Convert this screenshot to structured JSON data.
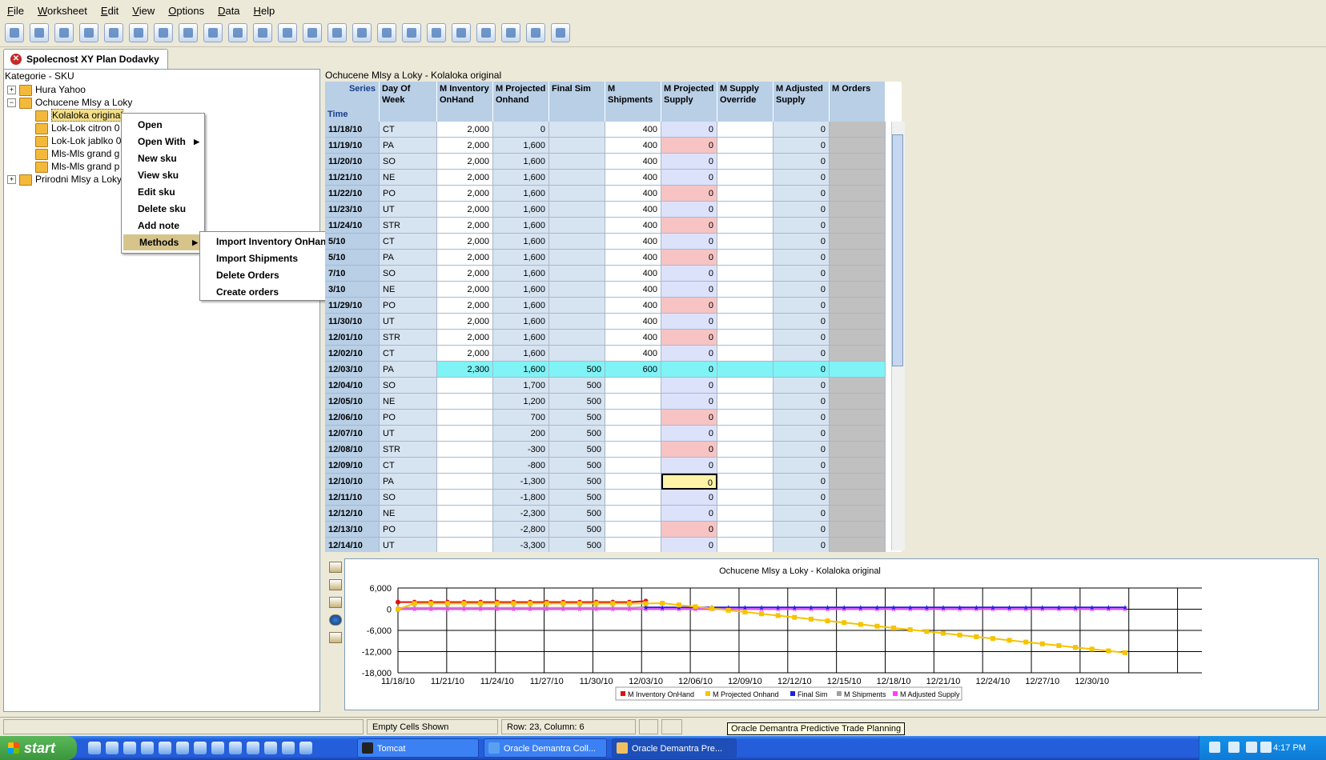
{
  "menubar": [
    "File",
    "Worksheet",
    "Edit",
    "View",
    "Options",
    "Data",
    "Help"
  ],
  "tab": {
    "title": "Spolecnost XY Plan Dodavky"
  },
  "left_panel": {
    "title": "Kategorie - SKU",
    "tree": [
      {
        "label": "Hura Yahoo",
        "level": 0,
        "toggle": "+"
      },
      {
        "label": "Ochucene Mlsy a Loky",
        "level": 0,
        "toggle": "-"
      },
      {
        "label": "Kolaloka original",
        "level": 1,
        "selected": true
      },
      {
        "label": "Lok-Lok citron 0",
        "level": 1
      },
      {
        "label": "Lok-Lok jablko 0",
        "level": 1
      },
      {
        "label": "Mls-Mls grand g",
        "level": 1
      },
      {
        "label": "Mls-Mls grand p",
        "level": 1
      },
      {
        "label": "Prirodni Mlsy a Loky",
        "level": 0,
        "toggle": "+"
      }
    ]
  },
  "context_menu": {
    "items": [
      "Open",
      "Open With",
      "New sku",
      "View sku",
      "Edit sku",
      "Delete sku",
      "Add note",
      "Methods"
    ],
    "submenu": [
      "Import Inventory OnHand",
      "Import Shipments",
      "Delete Orders",
      "Create orders"
    ]
  },
  "grid": {
    "title": "Ochucene Mlsy a Loky - Kolaloka original",
    "corner": {
      "series": "Series",
      "time": "Time"
    },
    "headers": [
      "Day Of Week",
      "M Inventory OnHand",
      "M Projected Onhand",
      "Final Sim",
      "M Shipments",
      "M Projected Supply",
      "M Supply Override",
      "M Adjusted Supply",
      "M Orders"
    ],
    "rows": [
      [
        "11/18/10",
        "CT",
        "2,000",
        "0",
        "",
        "400",
        "0",
        "",
        "0"
      ],
      [
        "11/19/10",
        "PA",
        "2,000",
        "1,600",
        "",
        "400",
        "0",
        "",
        "0"
      ],
      [
        "11/20/10",
        "SO",
        "2,000",
        "1,600",
        "",
        "400",
        "0",
        "",
        "0"
      ],
      [
        "11/21/10",
        "NE",
        "2,000",
        "1,600",
        "",
        "400",
        "0",
        "",
        "0"
      ],
      [
        "11/22/10",
        "PO",
        "2,000",
        "1,600",
        "",
        "400",
        "0",
        "",
        "0"
      ],
      [
        "11/23/10",
        "UT",
        "2,000",
        "1,600",
        "",
        "400",
        "0",
        "",
        "0"
      ],
      [
        "11/24/10",
        "STR",
        "2,000",
        "1,600",
        "",
        "400",
        "0",
        "",
        "0"
      ],
      [
        "5/10",
        "CT",
        "2,000",
        "1,600",
        "",
        "400",
        "0",
        "",
        "0"
      ],
      [
        "5/10",
        "PA",
        "2,000",
        "1,600",
        "",
        "400",
        "0",
        "",
        "0"
      ],
      [
        "7/10",
        "SO",
        "2,000",
        "1,600",
        "",
        "400",
        "0",
        "",
        "0"
      ],
      [
        "3/10",
        "NE",
        "2,000",
        "1,600",
        "",
        "400",
        "0",
        "",
        "0"
      ],
      [
        "11/29/10",
        "PO",
        "2,000",
        "1,600",
        "",
        "400",
        "0",
        "",
        "0"
      ],
      [
        "11/30/10",
        "UT",
        "2,000",
        "1,600",
        "",
        "400",
        "0",
        "",
        "0"
      ],
      [
        "12/01/10",
        "STR",
        "2,000",
        "1,600",
        "",
        "400",
        "0",
        "",
        "0"
      ],
      [
        "12/02/10",
        "CT",
        "2,000",
        "1,600",
        "",
        "400",
        "0",
        "",
        "0"
      ],
      [
        "12/03/10",
        "PA",
        "2,300",
        "1,600",
        "500",
        "600",
        "0",
        "",
        "0"
      ],
      [
        "12/04/10",
        "SO",
        "",
        "1,700",
        "500",
        "",
        "0",
        "",
        "0"
      ],
      [
        "12/05/10",
        "NE",
        "",
        "1,200",
        "500",
        "",
        "0",
        "",
        "0"
      ],
      [
        "12/06/10",
        "PO",
        "",
        "700",
        "500",
        "",
        "0",
        "",
        "0"
      ],
      [
        "12/07/10",
        "UT",
        "",
        "200",
        "500",
        "",
        "0",
        "",
        "0"
      ],
      [
        "12/08/10",
        "STR",
        "",
        "-300",
        "500",
        "",
        "0",
        "",
        "0"
      ],
      [
        "12/09/10",
        "CT",
        "",
        "-800",
        "500",
        "",
        "0",
        "",
        "0"
      ],
      [
        "12/10/10",
        "PA",
        "",
        "-1,300",
        "500",
        "",
        "0",
        "",
        "0"
      ],
      [
        "12/11/10",
        "SO",
        "",
        "-1,800",
        "500",
        "",
        "0",
        "",
        "0"
      ],
      [
        "12/12/10",
        "NE",
        "",
        "-2,300",
        "500",
        "",
        "0",
        "",
        "0"
      ],
      [
        "12/13/10",
        "PO",
        "",
        "-2,800",
        "500",
        "",
        "0",
        "",
        "0"
      ],
      [
        "12/14/10",
        "UT",
        "",
        "-3,300",
        "500",
        "",
        "0",
        "",
        "0"
      ]
    ],
    "pink_rows": [
      1,
      4,
      6,
      8,
      11,
      13,
      18,
      20,
      25
    ],
    "highlight_row": 15,
    "focus_row": 22
  },
  "chart_data": {
    "type": "line",
    "title": "Ochucene Mlsy a Loky - Kolaloka original",
    "x_tick_labels": [
      "11/18/10",
      "11/21/10",
      "11/24/10",
      "11/27/10",
      "11/30/10",
      "12/03/10",
      "12/06/10",
      "12/09/10",
      "12/12/10",
      "12/15/10",
      "12/18/10",
      "12/21/10",
      "12/24/10",
      "12/27/10",
      "12/30/10"
    ],
    "y_tick_labels": [
      "6,000",
      "0",
      "-6,000",
      "-12,000",
      "-18,000"
    ],
    "ylim": [
      -18000,
      6000
    ],
    "x_count": 45,
    "series": [
      {
        "name": "M Inventory OnHand",
        "color": "#e01010",
        "marker": "circle",
        "values": [
          2000,
          2000,
          2000,
          2000,
          2000,
          2000,
          2000,
          2000,
          2000,
          2000,
          2000,
          2000,
          2000,
          2000,
          2000,
          2300
        ]
      },
      {
        "name": "M Projected Onhand",
        "color": "#f5c400",
        "marker": "square",
        "values": [
          0,
          1600,
          1600,
          1600,
          1600,
          1600,
          1600,
          1600,
          1600,
          1600,
          1600,
          1600,
          1600,
          1600,
          1600,
          1600,
          1700,
          1200,
          700,
          200,
          -300,
          -800,
          -1300,
          -1800,
          -2300,
          -2800,
          -3300,
          -3800,
          -4300,
          -4800,
          -5300,
          -5800,
          -6300,
          -6800,
          -7300,
          -7800,
          -8300,
          -8800,
          -9300,
          -9800,
          -10300,
          -10800,
          -11300,
          -11800,
          -12300
        ]
      },
      {
        "name": "Final Sim",
        "color": "#2020e0",
        "marker": "star",
        "values": [
          null,
          null,
          null,
          null,
          null,
          null,
          null,
          null,
          null,
          null,
          null,
          null,
          null,
          null,
          null,
          500,
          500,
          500,
          500,
          500,
          500,
          500,
          500,
          500,
          500,
          500,
          500,
          500,
          500,
          500,
          500,
          500,
          500,
          500,
          500,
          500,
          500,
          500,
          500,
          500,
          500,
          500,
          500,
          500,
          500
        ]
      },
      {
        "name": "M Shipments",
        "color": "#a0a0a0",
        "marker": "diamond",
        "values": [
          400,
          400,
          400,
          400,
          400,
          400,
          400,
          400,
          400,
          400,
          400,
          400,
          400,
          400,
          400,
          600
        ]
      },
      {
        "name": "M Adjusted Supply",
        "color": "#ff40ff",
        "marker": "star",
        "values": [
          0,
          0,
          0,
          0,
          0,
          0,
          0,
          0,
          0,
          0,
          0,
          0,
          0,
          0,
          0,
          0,
          0,
          0,
          0,
          0,
          0,
          0,
          0,
          0,
          0,
          0,
          0,
          0,
          0,
          0,
          0,
          0,
          0,
          0,
          0,
          0,
          0,
          0,
          0,
          0,
          0,
          0,
          0,
          0,
          0
        ]
      }
    ]
  },
  "status": {
    "empty_cells": "Empty Cells Shown",
    "position": "Row: 23, Column: 6",
    "tooltip": "Oracle Demantra Predictive Trade Planning"
  },
  "taskbar": {
    "start": "start",
    "tasks": [
      "Tomcat",
      "Oracle Demantra Coll...",
      "Oracle Demantra Pre..."
    ],
    "clock": "4:17 PM"
  },
  "colors": {
    "header_blue": "#b8cfe6",
    "pink": "#f7c3c3",
    "cyan": "#7ff3f6",
    "taskbar": "#245edb"
  }
}
